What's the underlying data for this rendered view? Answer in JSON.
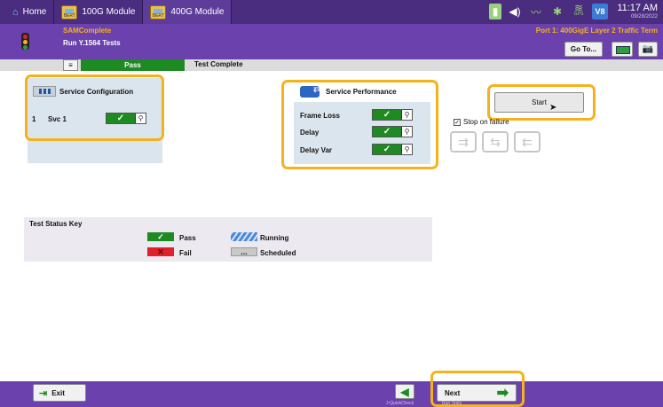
{
  "topbar": {
    "tabs": [
      {
        "label": "Home",
        "icon": "home-icon"
      },
      {
        "label": "100G Module",
        "icon": "bert-module-icon"
      },
      {
        "label": "400G Module",
        "icon": "bert-module-icon"
      }
    ],
    "bert_badge": "BERT",
    "gps_label": "GPS",
    "v8_label": "V8",
    "time": "11:17 AM",
    "date": "09/28/2022"
  },
  "subheader": {
    "app_name": "SAMComplete",
    "test_name": "Run Y.1564 Tests",
    "port_label": "Port 1: 400GigE Layer 2 Traffic Term",
    "goto_label": "Go To..."
  },
  "statusbar": {
    "result": "Pass",
    "status": "Test Complete"
  },
  "service_config": {
    "title": "Service Configuration",
    "rows": [
      {
        "index": "1",
        "name": "Svc 1"
      }
    ]
  },
  "service_performance": {
    "title": "Service Performance",
    "rows": [
      {
        "label": "Frame Loss"
      },
      {
        "label": "Delay"
      },
      {
        "label": "Delay Var"
      }
    ]
  },
  "controls": {
    "start_label": "Start",
    "stop_on_failure_label": "Stop on failure",
    "stop_on_failure_checked": true
  },
  "status_key": {
    "title": "Test Status Key",
    "items": [
      {
        "label": "Pass",
        "symbol": "✓"
      },
      {
        "label": "Running",
        "symbol": ""
      },
      {
        "label": "Fail",
        "symbol": "✕"
      },
      {
        "label": "Scheduled",
        "symbol": "..."
      }
    ]
  },
  "footer": {
    "exit_label": "Exit",
    "back_sub": "J-QuickCheck",
    "next_label": "Next",
    "next_sub": "Run Tests"
  },
  "colors": {
    "header_purple": "#6b41ad",
    "tab_purple": "#4a2d7e",
    "pass_green": "#1e8a22",
    "fail_red": "#e0202a",
    "highlight_orange": "#f5b21c"
  }
}
